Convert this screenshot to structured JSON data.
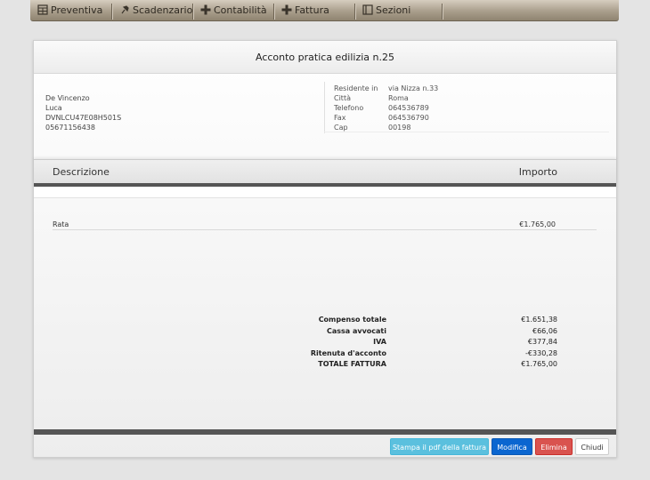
{
  "nav": {
    "items": [
      {
        "label": "Preventiva",
        "icon": "calculator-icon"
      },
      {
        "label": "Scadenzario",
        "icon": "pin-icon"
      },
      {
        "label": "Contabilità",
        "icon": "plus-icon"
      },
      {
        "label": "Fattura",
        "icon": "plus-icon"
      },
      {
        "label": "Sezioni",
        "icon": "book-icon"
      }
    ]
  },
  "document": {
    "title": "Acconto pratica edilizia n.25",
    "client": {
      "surname": "De Vincenzo",
      "name": "Luca",
      "fiscal_code": "DVNLCU47E08H501S",
      "vat": "05671156438"
    },
    "details": [
      {
        "label": "Residente in",
        "value": "via Nizza n.33"
      },
      {
        "label": "Città",
        "value": "Roma"
      },
      {
        "label": "Telefono",
        "value": "064536789"
      },
      {
        "label": "Fax",
        "value": "064536790"
      },
      {
        "label": "Cap",
        "value": "00198"
      }
    ],
    "table": {
      "header_desc": "Descrizione",
      "header_amount": "Importo",
      "rows": [
        {
          "desc": "Rata",
          "amount": "€1.765,00"
        }
      ]
    },
    "totals": [
      {
        "label": "Compenso totale",
        "value": "€1.651,38"
      },
      {
        "label": "Cassa avvocati",
        "value": "€66,06"
      },
      {
        "label": "IVA",
        "value": "€377,84"
      },
      {
        "label": "Ritenuta d'acconto",
        "value": "-€330,28"
      },
      {
        "label": "TOTALE FATTURA",
        "value": "€1.765,00"
      }
    ]
  },
  "buttons": {
    "pdf": "Stampa il pdf della fattura",
    "edit": "Modifica",
    "delete": "Elimina",
    "close": "Chiudi"
  },
  "colors": {
    "nav_bar": "#a99e8c",
    "btn_info": "#5bc0de",
    "btn_primary": "#0b66d0",
    "btn_danger": "#d9534f"
  }
}
